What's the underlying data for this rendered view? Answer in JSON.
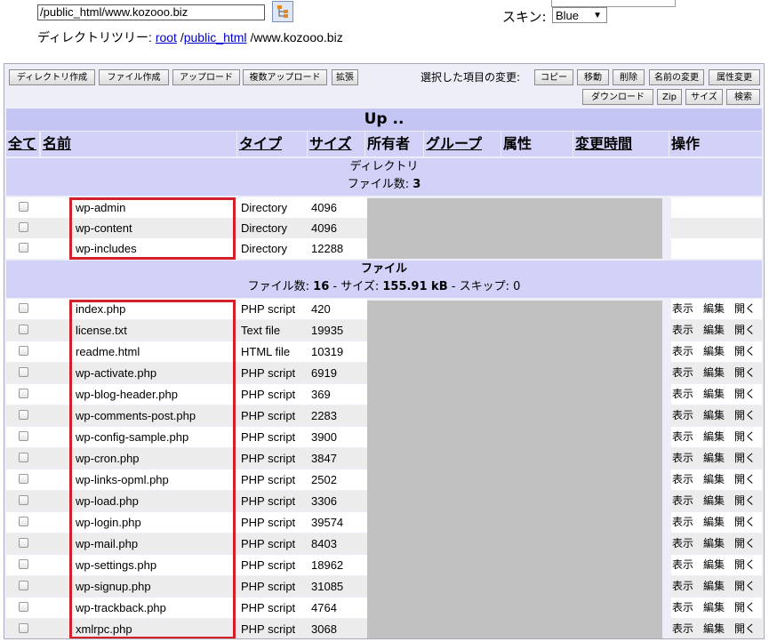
{
  "top": {
    "path_value": "/public_html/www.kozooo.biz",
    "breadcrumb_prefix": "ディレクトリツリー:",
    "breadcrumb_root": "root",
    "breadcrumb_public": "public_html",
    "breadcrumb_current": "/www.kozooo.biz",
    "skin_label": "スキン:",
    "skin_value": "Blue"
  },
  "toolbar": {
    "left_buttons": [
      "ディレクトリ作成",
      "ファイル作成",
      "アップロード",
      "複数アップロード",
      "拡張"
    ],
    "selected_label": "選択した項目の変更:",
    "right_buttons": [
      "コピー",
      "移動",
      "削除",
      "名前の変更",
      "属性変更"
    ],
    "right_buttons2": [
      "ダウンロード",
      "Zip",
      "サイズ",
      "検索"
    ]
  },
  "up_label": "Up ..",
  "headers": [
    "全て",
    "名前",
    "タイプ",
    "サイズ",
    "所有者",
    "グループ",
    "属性",
    "変更時間",
    "操作"
  ],
  "dir_section": {
    "title": "ディレクトリ",
    "count_label": "ファイル数:",
    "count": "3"
  },
  "directories": [
    {
      "name": "wp-admin",
      "type": "Directory",
      "size": "4096"
    },
    {
      "name": "wp-content",
      "type": "Directory",
      "size": "4096"
    },
    {
      "name": "wp-includes",
      "type": "Directory",
      "size": "12288"
    }
  ],
  "file_section": {
    "title": "ファイル",
    "count_label": "ファイル数:",
    "count": "16",
    "size_label": "- サイズ:",
    "size": "155.91 kB",
    "skip_label": "- スキップ: 0"
  },
  "files": [
    {
      "name": "index.php",
      "type": "PHP script",
      "size": "420",
      "icon": "php-icon"
    },
    {
      "name": "license.txt",
      "type": "Text file",
      "size": "19935",
      "icon": "text-file-icon"
    },
    {
      "name": "readme.html",
      "type": "HTML file",
      "size": "10319",
      "icon": "html-globe-icon"
    },
    {
      "name": "wp-activate.php",
      "type": "PHP script",
      "size": "6919",
      "icon": "php-icon"
    },
    {
      "name": "wp-blog-header.php",
      "type": "PHP script",
      "size": "369",
      "icon": "php-icon"
    },
    {
      "name": "wp-comments-post.php",
      "type": "PHP script",
      "size": "2283",
      "icon": "php-icon"
    },
    {
      "name": "wp-config-sample.php",
      "type": "PHP script",
      "size": "3900",
      "icon": "php-icon"
    },
    {
      "name": "wp-cron.php",
      "type": "PHP script",
      "size": "3847",
      "icon": "php-icon"
    },
    {
      "name": "wp-links-opml.php",
      "type": "PHP script",
      "size": "2502",
      "icon": "php-icon"
    },
    {
      "name": "wp-load.php",
      "type": "PHP script",
      "size": "3306",
      "icon": "php-icon"
    },
    {
      "name": "wp-login.php",
      "type": "PHP script",
      "size": "39574",
      "icon": "php-icon"
    },
    {
      "name": "wp-mail.php",
      "type": "PHP script",
      "size": "8403",
      "icon": "php-icon"
    },
    {
      "name": "wp-settings.php",
      "type": "PHP script",
      "size": "18962",
      "icon": "php-icon"
    },
    {
      "name": "wp-signup.php",
      "type": "PHP script",
      "size": "31085",
      "icon": "php-icon"
    },
    {
      "name": "wp-trackback.php",
      "type": "PHP script",
      "size": "4764",
      "icon": "php-icon"
    },
    {
      "name": "xmlrpc.php",
      "type": "PHP script",
      "size": "3068",
      "icon": "php-icon"
    }
  ],
  "file_actions": [
    "表示",
    "編集",
    "開く"
  ],
  "colors": {
    "header_bg": "#d2d2f8",
    "up_bg": "#c5c5f4",
    "highlight": "#d4202a",
    "masked": "#c1c1c1"
  }
}
